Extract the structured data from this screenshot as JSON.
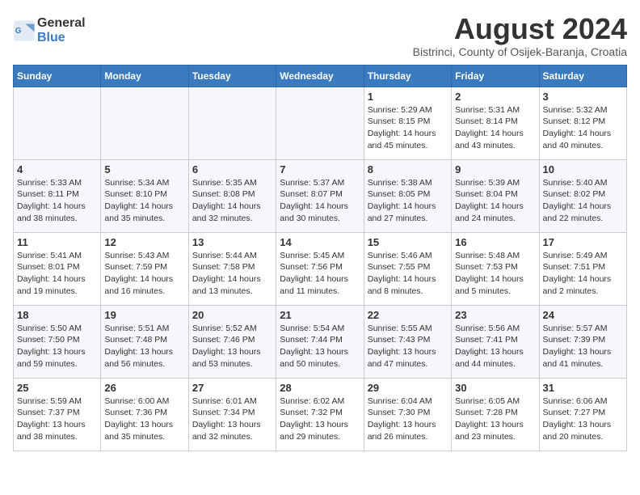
{
  "header": {
    "logo_line1": "General",
    "logo_line2": "Blue",
    "month_year": "August 2024",
    "subtitle": "Bistrinci, County of Osijek-Baranja, Croatia"
  },
  "weekdays": [
    "Sunday",
    "Monday",
    "Tuesday",
    "Wednesday",
    "Thursday",
    "Friday",
    "Saturday"
  ],
  "weeks": [
    [
      {
        "day": "",
        "detail": ""
      },
      {
        "day": "",
        "detail": ""
      },
      {
        "day": "",
        "detail": ""
      },
      {
        "day": "",
        "detail": ""
      },
      {
        "day": "1",
        "detail": "Sunrise: 5:29 AM\nSunset: 8:15 PM\nDaylight: 14 hours\nand 45 minutes."
      },
      {
        "day": "2",
        "detail": "Sunrise: 5:31 AM\nSunset: 8:14 PM\nDaylight: 14 hours\nand 43 minutes."
      },
      {
        "day": "3",
        "detail": "Sunrise: 5:32 AM\nSunset: 8:12 PM\nDaylight: 14 hours\nand 40 minutes."
      }
    ],
    [
      {
        "day": "4",
        "detail": "Sunrise: 5:33 AM\nSunset: 8:11 PM\nDaylight: 14 hours\nand 38 minutes."
      },
      {
        "day": "5",
        "detail": "Sunrise: 5:34 AM\nSunset: 8:10 PM\nDaylight: 14 hours\nand 35 minutes."
      },
      {
        "day": "6",
        "detail": "Sunrise: 5:35 AM\nSunset: 8:08 PM\nDaylight: 14 hours\nand 32 minutes."
      },
      {
        "day": "7",
        "detail": "Sunrise: 5:37 AM\nSunset: 8:07 PM\nDaylight: 14 hours\nand 30 minutes."
      },
      {
        "day": "8",
        "detail": "Sunrise: 5:38 AM\nSunset: 8:05 PM\nDaylight: 14 hours\nand 27 minutes."
      },
      {
        "day": "9",
        "detail": "Sunrise: 5:39 AM\nSunset: 8:04 PM\nDaylight: 14 hours\nand 24 minutes."
      },
      {
        "day": "10",
        "detail": "Sunrise: 5:40 AM\nSunset: 8:02 PM\nDaylight: 14 hours\nand 22 minutes."
      }
    ],
    [
      {
        "day": "11",
        "detail": "Sunrise: 5:41 AM\nSunset: 8:01 PM\nDaylight: 14 hours\nand 19 minutes."
      },
      {
        "day": "12",
        "detail": "Sunrise: 5:43 AM\nSunset: 7:59 PM\nDaylight: 14 hours\nand 16 minutes."
      },
      {
        "day": "13",
        "detail": "Sunrise: 5:44 AM\nSunset: 7:58 PM\nDaylight: 14 hours\nand 13 minutes."
      },
      {
        "day": "14",
        "detail": "Sunrise: 5:45 AM\nSunset: 7:56 PM\nDaylight: 14 hours\nand 11 minutes."
      },
      {
        "day": "15",
        "detail": "Sunrise: 5:46 AM\nSunset: 7:55 PM\nDaylight: 14 hours\nand 8 minutes."
      },
      {
        "day": "16",
        "detail": "Sunrise: 5:48 AM\nSunset: 7:53 PM\nDaylight: 14 hours\nand 5 minutes."
      },
      {
        "day": "17",
        "detail": "Sunrise: 5:49 AM\nSunset: 7:51 PM\nDaylight: 14 hours\nand 2 minutes."
      }
    ],
    [
      {
        "day": "18",
        "detail": "Sunrise: 5:50 AM\nSunset: 7:50 PM\nDaylight: 13 hours\nand 59 minutes."
      },
      {
        "day": "19",
        "detail": "Sunrise: 5:51 AM\nSunset: 7:48 PM\nDaylight: 13 hours\nand 56 minutes."
      },
      {
        "day": "20",
        "detail": "Sunrise: 5:52 AM\nSunset: 7:46 PM\nDaylight: 13 hours\nand 53 minutes."
      },
      {
        "day": "21",
        "detail": "Sunrise: 5:54 AM\nSunset: 7:44 PM\nDaylight: 13 hours\nand 50 minutes."
      },
      {
        "day": "22",
        "detail": "Sunrise: 5:55 AM\nSunset: 7:43 PM\nDaylight: 13 hours\nand 47 minutes."
      },
      {
        "day": "23",
        "detail": "Sunrise: 5:56 AM\nSunset: 7:41 PM\nDaylight: 13 hours\nand 44 minutes."
      },
      {
        "day": "24",
        "detail": "Sunrise: 5:57 AM\nSunset: 7:39 PM\nDaylight: 13 hours\nand 41 minutes."
      }
    ],
    [
      {
        "day": "25",
        "detail": "Sunrise: 5:59 AM\nSunset: 7:37 PM\nDaylight: 13 hours\nand 38 minutes."
      },
      {
        "day": "26",
        "detail": "Sunrise: 6:00 AM\nSunset: 7:36 PM\nDaylight: 13 hours\nand 35 minutes."
      },
      {
        "day": "27",
        "detail": "Sunrise: 6:01 AM\nSunset: 7:34 PM\nDaylight: 13 hours\nand 32 minutes."
      },
      {
        "day": "28",
        "detail": "Sunrise: 6:02 AM\nSunset: 7:32 PM\nDaylight: 13 hours\nand 29 minutes."
      },
      {
        "day": "29",
        "detail": "Sunrise: 6:04 AM\nSunset: 7:30 PM\nDaylight: 13 hours\nand 26 minutes."
      },
      {
        "day": "30",
        "detail": "Sunrise: 6:05 AM\nSunset: 7:28 PM\nDaylight: 13 hours\nand 23 minutes."
      },
      {
        "day": "31",
        "detail": "Sunrise: 6:06 AM\nSunset: 7:27 PM\nDaylight: 13 hours\nand 20 minutes."
      }
    ]
  ]
}
